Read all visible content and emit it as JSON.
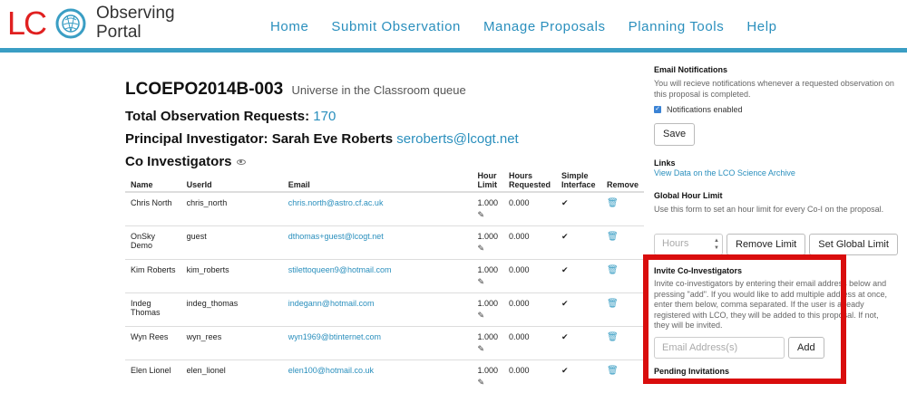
{
  "logo": {
    "mark": "LC",
    "line1": "Observing",
    "line2": "Portal"
  },
  "nav": [
    "Home",
    "Submit Observation",
    "Manage Proposals",
    "Planning Tools",
    "Help"
  ],
  "proposal": {
    "id": "LCOEPO2014B-003",
    "subtitle": "Universe in the Classroom queue",
    "total_label": "Total Observation Requests:",
    "total_value": "170",
    "pi_label": "Principal Investigator: Sarah Eve Roberts",
    "pi_email": "seroberts@lcogt.net",
    "coi_label": "Co Investigators"
  },
  "table": {
    "headers": [
      "Name",
      "UserId",
      "Email",
      "Hour Limit",
      "Hours Requested",
      "Simple Interface",
      "Remove"
    ],
    "rows": [
      {
        "name": "Chris North",
        "user": "chris_north",
        "email": "chris.north@astro.cf.ac.uk",
        "limit": "1.000",
        "requested": "0.000"
      },
      {
        "name": "OnSky Demo",
        "user": "guest",
        "email": "dthomas+guest@lcogt.net",
        "limit": "1.000",
        "requested": "0.000"
      },
      {
        "name": "Kim Roberts",
        "user": "kim_roberts",
        "email": "stilettoqueen9@hotmail.com",
        "limit": "1.000",
        "requested": "0.000"
      },
      {
        "name": "Indeg Thomas",
        "user": "indeg_thomas",
        "email": "indegann@hotmail.com",
        "limit": "1.000",
        "requested": "0.000"
      },
      {
        "name": "Wyn Rees",
        "user": "wyn_rees",
        "email": "wyn1969@btinternet.com",
        "limit": "1.000",
        "requested": "0.000"
      },
      {
        "name": "Elen Lionel",
        "user": "elen_lionel",
        "email": "elen100@hotmail.co.uk",
        "limit": "1.000",
        "requested": "0.000"
      }
    ]
  },
  "side": {
    "notif_title": "Email Notifications",
    "notif_desc": "You will recieve notifications whenever a requested observation on this proposal is completed.",
    "notif_checkbox": "Notifications enabled",
    "save": "Save",
    "links_title": "Links",
    "links_item": "View Data on the LCO Science Archive",
    "ghl_title": "Global Hour Limit",
    "ghl_desc": "Use this form to set an hour limit for every Co-I on the proposal.",
    "hours_placeholder": "Hours",
    "remove_limit": "Remove Limit",
    "set_limit": "Set Global Limit",
    "invite_title": "Invite Co-Investigators",
    "invite_desc": "Invite co-investigators by entering their email address below and pressing \"add\". If you would like to add multiple address at once, enter them below, comma separated. If the user is already registered with LCO, they will be added to this proposal. If not, they will be invited.",
    "email_placeholder": "Email Address(s)",
    "add": "Add",
    "pending": "Pending Invitations"
  },
  "colors": {
    "accent": "#2a8fbd",
    "brand_red": "#e02020",
    "highlight": "#d90d0d"
  }
}
